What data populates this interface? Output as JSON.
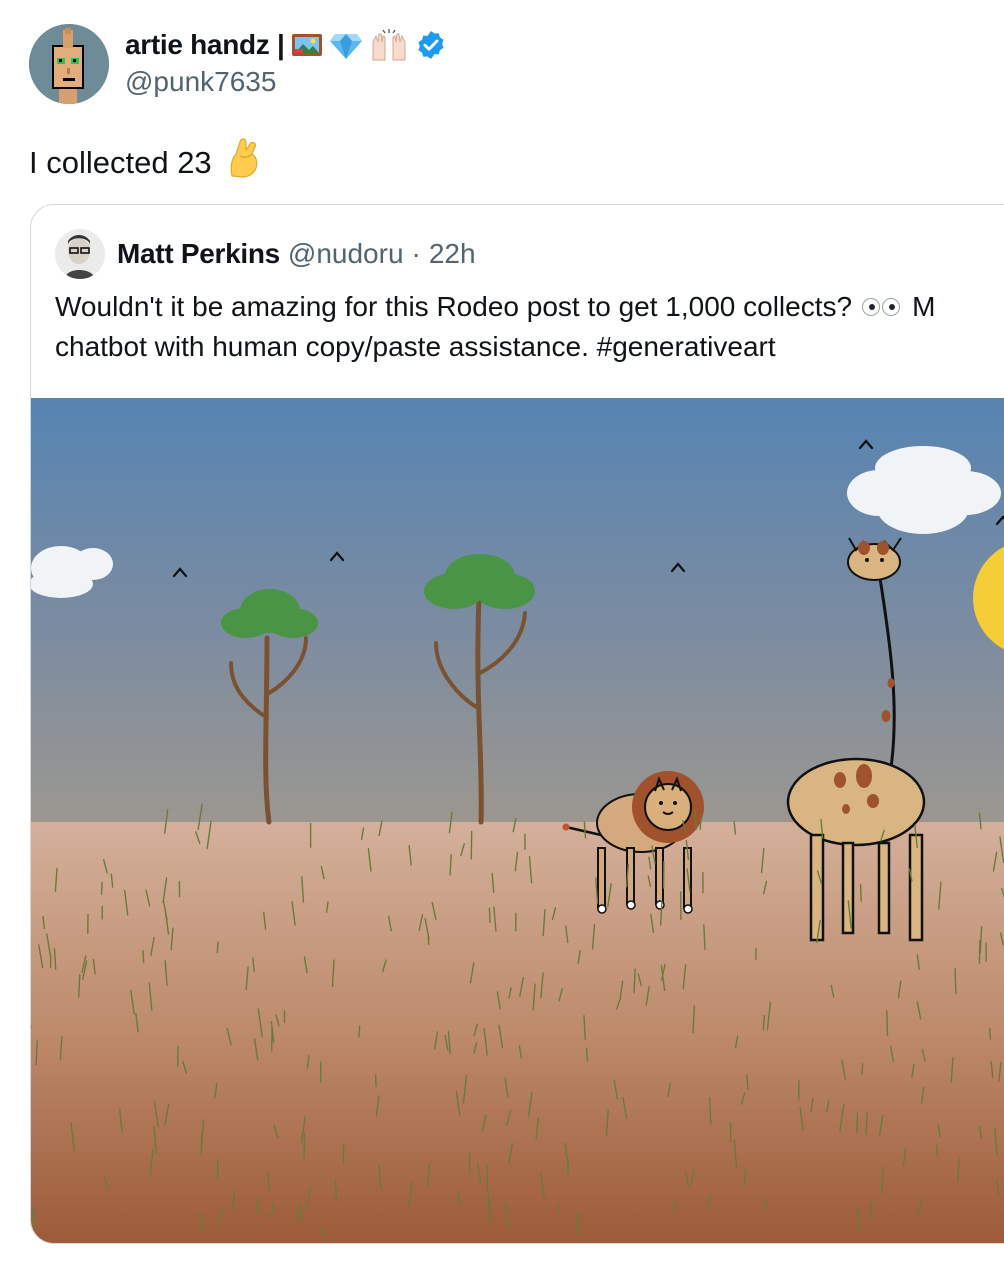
{
  "author": {
    "display_name": "artie handz |",
    "handle": "@punk7635",
    "name_icons": [
      "framed-picture-icon",
      "gem-icon",
      "raised-hands-icon",
      "verified-badge-icon"
    ],
    "avatar_icon": "cryptopunk-avatar"
  },
  "tweet": {
    "text": "I collected 23",
    "emoji_icon": "pinched-fingers-icon"
  },
  "quote": {
    "author_name": "Matt Perkins",
    "author_handle": "@nudoru",
    "separator": "·",
    "time": "22h",
    "line1": "Wouldn't it be amazing for this Rodeo post to get 1,000 collects?",
    "line1_tail": "M",
    "line2": "chatbot with human copy/paste assistance. #generativeart",
    "eyes_icon": "eyes-icon",
    "media_description_icons": [
      "cloud-icon",
      "bird-icon",
      "tree-icon",
      "lion-icon",
      "giraffe-icon",
      "sun-icon"
    ]
  },
  "colors": {
    "verified": "#1d9bf0",
    "secondary_text": "#536471",
    "card_border": "#cfd9de",
    "sky_top": "#5684b2",
    "sky_bottom": "#9b9790",
    "ground_top": "#d4b09b",
    "ground_bottom": "#9c5a38",
    "tree_leaves": "#4a9445",
    "tree_trunk": "#7a5232",
    "sun": "#f5cd36"
  }
}
